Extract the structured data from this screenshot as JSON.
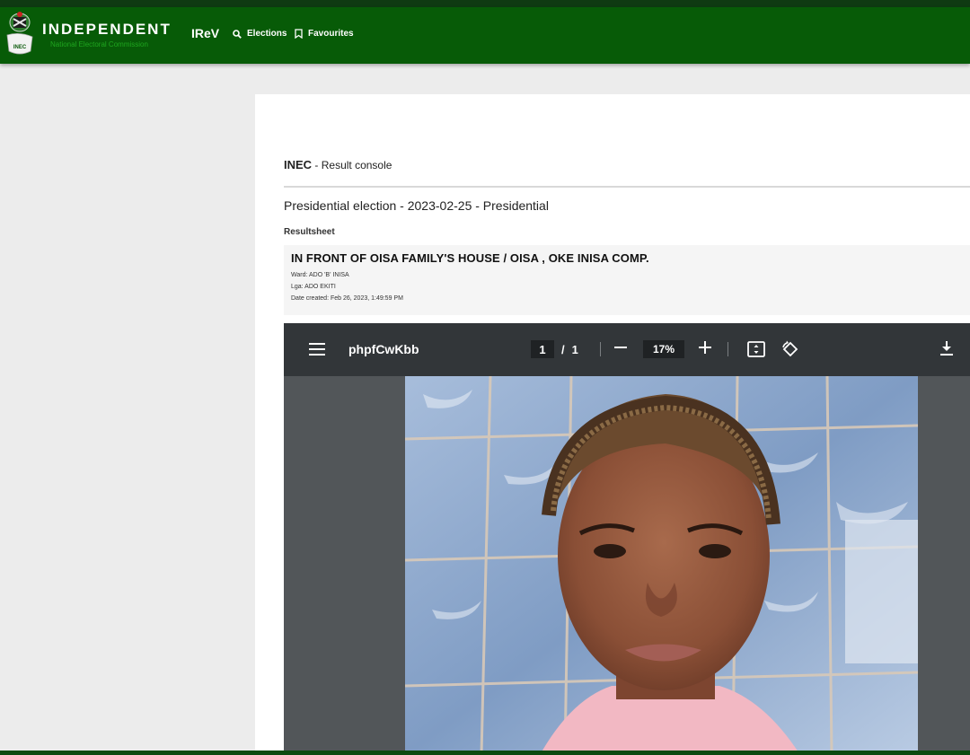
{
  "header": {
    "brand_title": "INDEPENDENT",
    "brand_subtitle": "National Electoral Commission",
    "logo_text": "INEC",
    "app_name": "IReV",
    "nav": [
      {
        "label": "Elections",
        "icon": "search-icon"
      },
      {
        "label": "Favourites",
        "icon": "bookmark-icon"
      }
    ]
  },
  "console": {
    "org": "INEC",
    "title": " - Result console"
  },
  "election": {
    "title": "Presidential election - 2023-02-25 - Presidential",
    "section_label": "Resultsheet"
  },
  "polling_unit": {
    "name": "IN FRONT OF OISA FAMILY'S HOUSE / OISA , OKE INISA COMP.",
    "ward": "Ward: ADO 'B' INISA",
    "lga": "Lga: ADO EKITI",
    "date_created": "Date created: Feb 26, 2023, 1:49:59 PM"
  },
  "viewer": {
    "filename": "phpfCwKbb",
    "current_page": "1",
    "page_separator": "/",
    "total_pages": "1",
    "zoom": "17%",
    "icons": [
      "menu-icon",
      "fit-page-icon",
      "rotate-icon",
      "download-icon"
    ]
  },
  "colors": {
    "header_green": "#075b07",
    "brand_sub_green": "#1fa61f",
    "viewer_toolbar": "#323639",
    "viewer_background": "#525659"
  }
}
